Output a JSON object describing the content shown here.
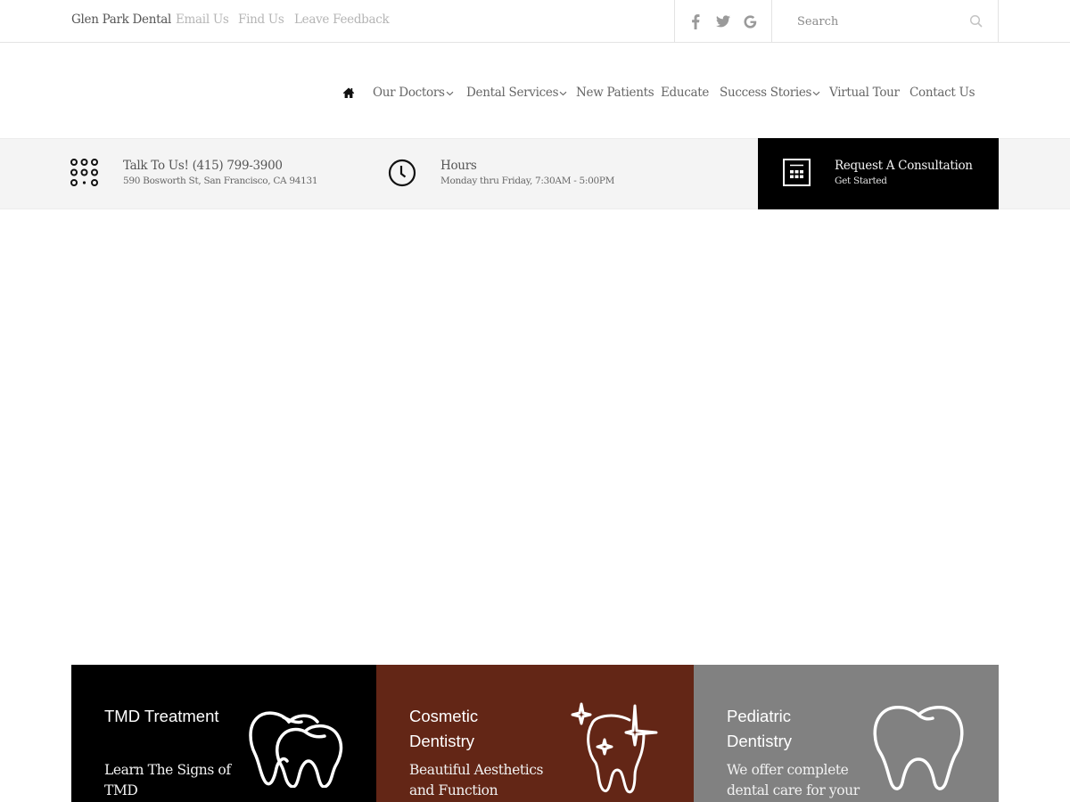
{
  "topbar": {
    "brand": "Glen Park Dental",
    "links": [
      "Email Us",
      "Find Us",
      "Leave Feedback"
    ],
    "social": [
      "facebook-icon",
      "twitter-icon",
      "google-icon"
    ],
    "search": {
      "placeholder": "Search",
      "value": ""
    }
  },
  "nav": {
    "home_icon": "home-icon",
    "items": [
      {
        "label": "Our Doctors",
        "has_dropdown": true
      },
      {
        "label": "Dental Services",
        "has_dropdown": true
      },
      {
        "label": "New Patients",
        "has_dropdown": false
      },
      {
        "label": "Educate",
        "has_dropdown": false
      },
      {
        "label": "Success Stories",
        "has_dropdown": true
      },
      {
        "label": "Virtual Tour",
        "has_dropdown": false
      },
      {
        "label": "Contact Us",
        "has_dropdown": false
      }
    ]
  },
  "infobar": {
    "phone": {
      "icon": "dialpad-icon",
      "title": "Talk To Us! (415) 799-3900",
      "subtitle": "590 Bosworth St, San Francisco, CA 94131"
    },
    "hours": {
      "icon": "clock-icon",
      "title": "Hours",
      "subtitle": "Monday thru Friday, 7:30AM - 5:00PM"
    },
    "consultation": {
      "icon": "calculator-icon",
      "title": "Request A Consultation",
      "subtitle": "Get Started"
    }
  },
  "services": [
    {
      "title": "TMD Treatment",
      "description": "Learn The Signs of TMD",
      "icon": "two-teeth-icon",
      "color": "#000000"
    },
    {
      "title": "Cosmetic Dentistry",
      "description": "Beautiful Aesthetics and Function",
      "icon": "sparkling-tooth-icon",
      "color": "#632616"
    },
    {
      "title": "Pediatric Dentistry",
      "description": "We offer complete dental care for your",
      "icon": "tooth-icon",
      "color": "#818181"
    }
  ]
}
